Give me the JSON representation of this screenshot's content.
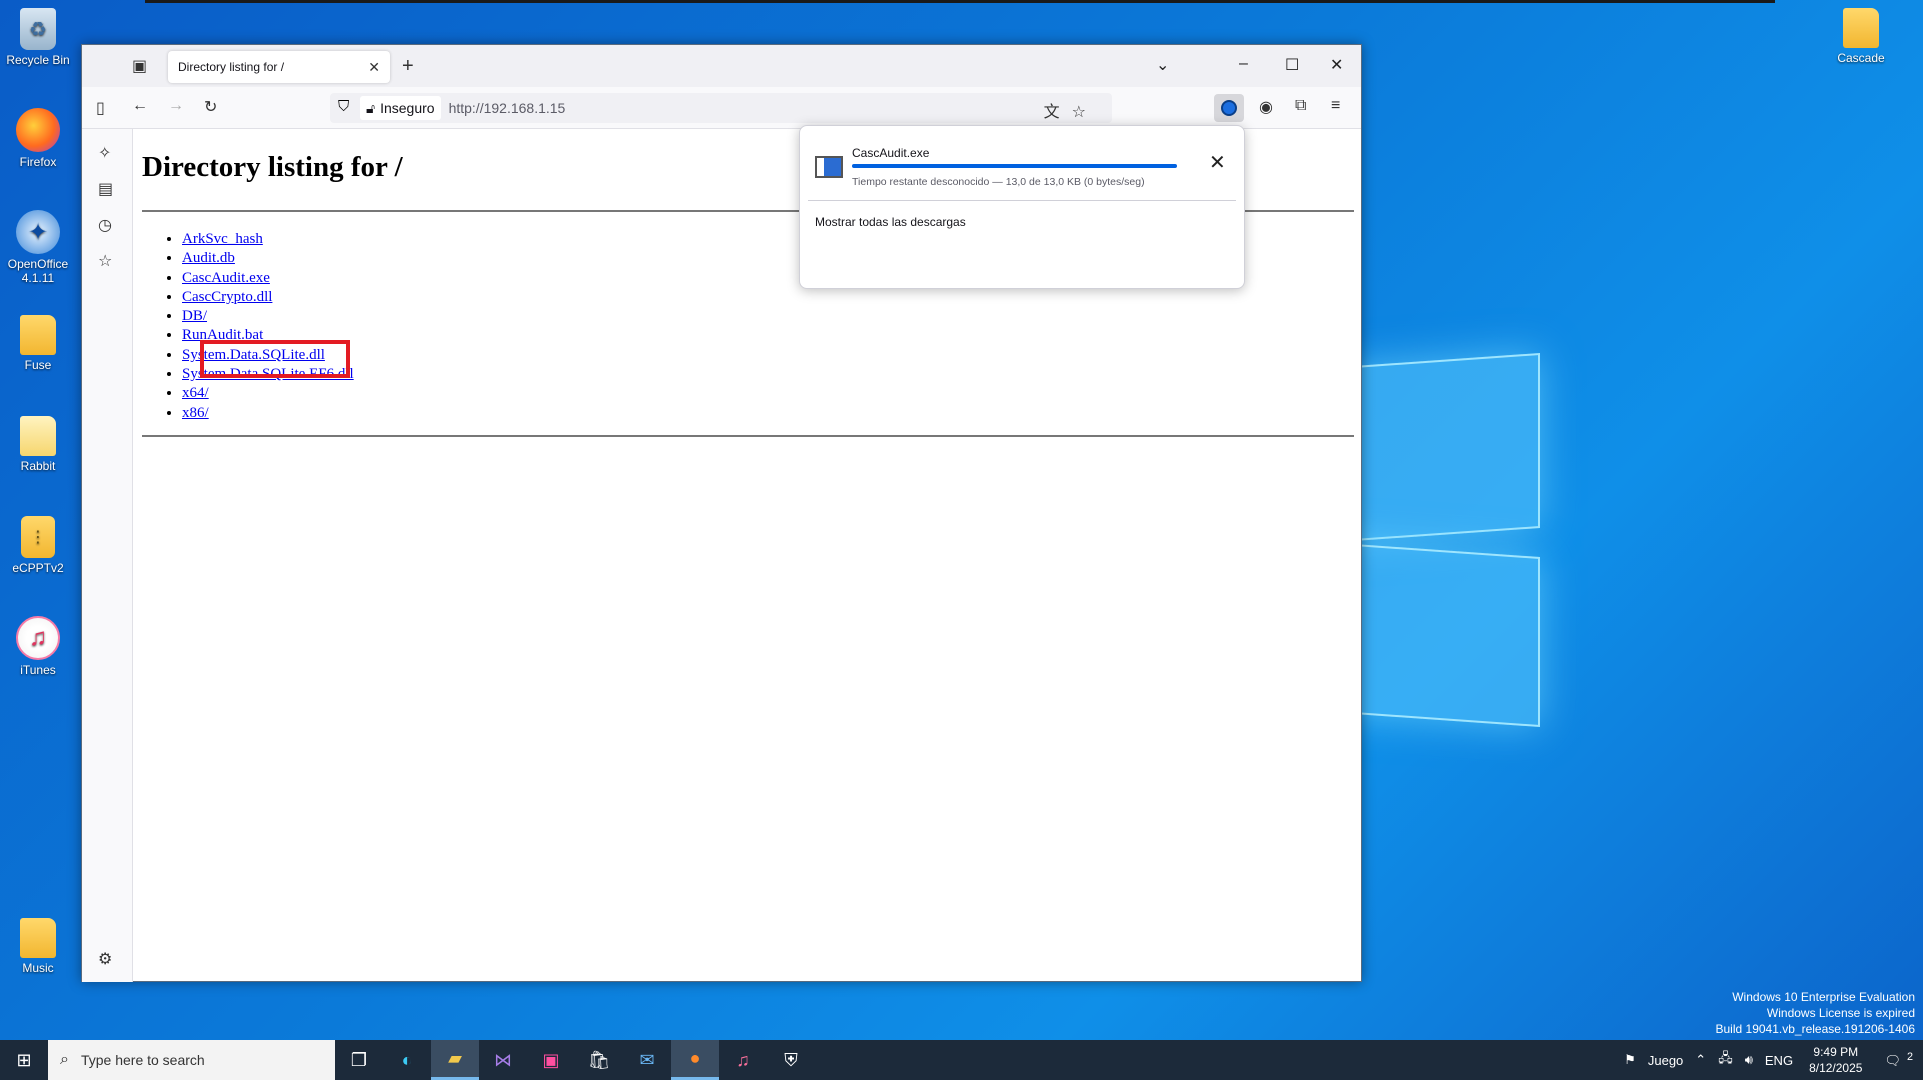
{
  "desktop": {
    "icons": [
      {
        "label": "Recycle Bin"
      },
      {
        "label": "Firefox"
      },
      {
        "label": "OpenOffice 4.1.11"
      },
      {
        "label": "Fuse"
      },
      {
        "label": "Rabbit"
      },
      {
        "label": "eCPPTv2"
      },
      {
        "label": "iTunes"
      },
      {
        "label": "Music"
      },
      {
        "label": "Cascade"
      }
    ],
    "watermark": {
      "line1": "Windows 10 Enterprise Evaluation",
      "line2": "Windows License is expired",
      "line3": "Build 19041.vb_release.191206-1406"
    }
  },
  "browser": {
    "tab_title": "Directory listing for /",
    "security_label": "Inseguro",
    "url": "http://192.168.1.15",
    "page": {
      "heading": "Directory listing for /",
      "files": [
        "ArkSvc_hash",
        "Audit.db",
        "CascAudit.exe",
        "CascCrypto.dll",
        "DB/",
        "RunAudit.bat",
        "System.Data.SQLite.dll",
        "System.Data.SQLite.EF6.dll",
        "x64/",
        "x86/"
      ]
    },
    "downloads": {
      "file_name": "CascAudit.exe",
      "status": "Tiempo restante desconocido — 13,0 de 13,0 KB (0 bytes/seg)",
      "progress_percent": 100,
      "show_all": "Mostrar todas las descargas"
    }
  },
  "taskbar": {
    "search_placeholder": "Type here to search",
    "weather": "Juego",
    "language": "ENG",
    "time": "9:49 PM",
    "date": "8/12/2025",
    "notifications": "2"
  }
}
